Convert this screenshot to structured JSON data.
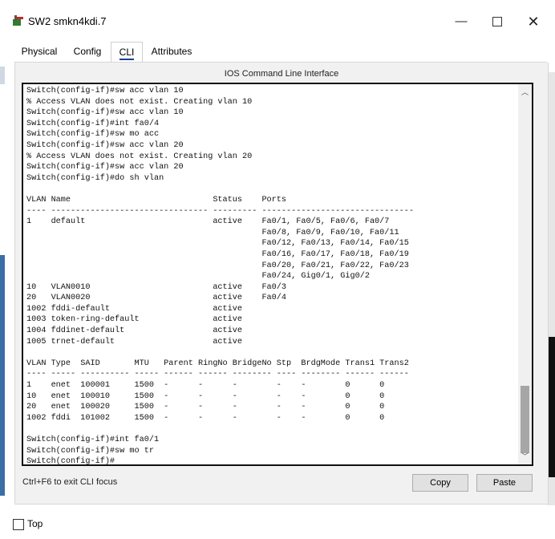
{
  "window": {
    "title": "SW2 smkn4kdi.7",
    "minimize": "—",
    "close": "✕"
  },
  "tabs": [
    {
      "label": "Physical",
      "active": false
    },
    {
      "label": "Config",
      "active": false
    },
    {
      "label": "CLI",
      "active": true
    },
    {
      "label": "Attributes",
      "active": false
    }
  ],
  "cli": {
    "panel_title": "IOS Command Line Interface",
    "lines": [
      "Switch(config-if)#sw acc vlan 10",
      "% Access VLAN does not exist. Creating vlan 10",
      "Switch(config-if)#sw acc vlan 10",
      "Switch(config-if)#int fa0/4",
      "Switch(config-if)#sw mo acc",
      "Switch(config-if)#sw acc vlan 20",
      "% Access VLAN does not exist. Creating vlan 20",
      "Switch(config-if)#sw acc vlan 20",
      "Switch(config-if)#do sh vlan",
      "",
      "VLAN Name                             Status    Ports",
      "---- -------------------------------- --------- -------------------------------",
      "1    default                          active    Fa0/1, Fa0/5, Fa0/6, Fa0/7",
      "                                                Fa0/8, Fa0/9, Fa0/10, Fa0/11",
      "                                                Fa0/12, Fa0/13, Fa0/14, Fa0/15",
      "                                                Fa0/16, Fa0/17, Fa0/18, Fa0/19",
      "                                                Fa0/20, Fa0/21, Fa0/22, Fa0/23",
      "                                                Fa0/24, Gig0/1, Gig0/2",
      "10   VLAN0010                         active    Fa0/3",
      "20   VLAN0020                         active    Fa0/4",
      "1002 fddi-default                     active",
      "1003 token-ring-default               active",
      "1004 fddinet-default                  active",
      "1005 trnet-default                    active",
      "",
      "VLAN Type  SAID       MTU   Parent RingNo BridgeNo Stp  BrdgMode Trans1 Trans2",
      "---- ----- ---------- ----- ------ ------ -------- ---- -------- ------ ------",
      "1    enet  100001     1500  -      -      -        -    -        0      0",
      "10   enet  100010     1500  -      -      -        -    -        0      0",
      "20   enet  100020     1500  -      -      -        -    -        0      0",
      "1002 fddi  101002     1500  -      -      -        -    -        0      0",
      "",
      "Switch(config-if)#int fa0/1",
      "Switch(config-if)#sw mo tr",
      "Switch(config-if)#"
    ]
  },
  "footer": {
    "hint": "Ctrl+F6 to exit CLI focus",
    "copy_label": "Copy",
    "paste_label": "Paste"
  },
  "top_checkbox": {
    "label": "Top",
    "checked": false
  }
}
